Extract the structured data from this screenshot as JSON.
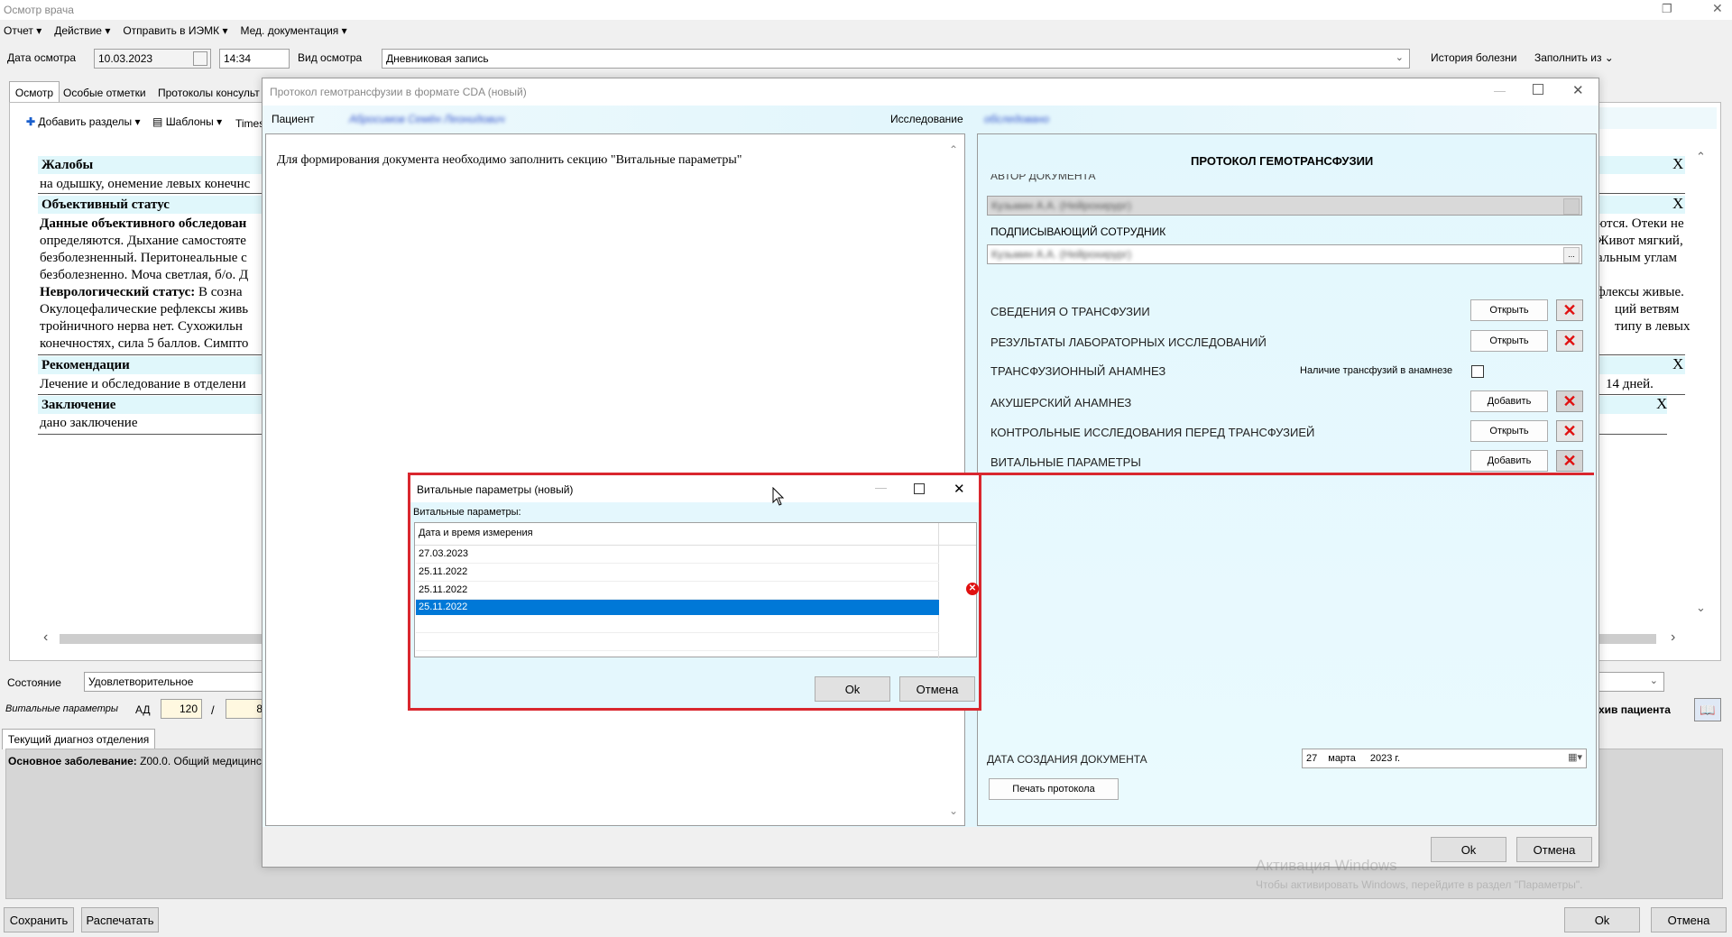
{
  "window": {
    "title": "Осмотр врача"
  },
  "menu": [
    "Отчет",
    "Действие",
    "Отправить в ИЭМК",
    "Мед. документация"
  ],
  "toolbar": {
    "date_label": "Дата осмотра",
    "date_value": "10.03.2023",
    "time_value": "14:34",
    "type_label": "Вид осмотра",
    "type_value": "Дневниковая запись",
    "history_link": "История болезни",
    "fill_from": "Заполнить из"
  },
  "tabs": [
    "Осмотр",
    "Особые отметки",
    "Протоколы консульт"
  ],
  "editor_toolbar": {
    "add_sections": "Добавить разделы",
    "templates": "Шаблоны",
    "times": "Times"
  },
  "sections": [
    {
      "title": "Жалобы",
      "text": "на одышку, онемение левых конечнс"
    },
    {
      "title": "Объективный статус",
      "text": ""
    }
  ],
  "body_lines": {
    "objective_title": "Данные объективного обследован",
    "l1": "определяются. Дыхание самостояте",
    "l2": "безболезненный. Перитонеальные с",
    "l3": "безболезненно. Моча светлая, б/о. Д",
    "neuro_title": "Неврологический статус:",
    "neuro_text": " В созна",
    "l5": "Окулоцефалические рефлексы живь",
    "l6": "тройничного нерва нет. Сухожильн",
    "l7": "конечностях, сила 5 баллов. Симпто",
    "rec_title": "Рекомендации",
    "rec_text": "Лечение и обследование в отделени",
    "concl_title": "Заключение",
    "concl_text": "дано заключение",
    "r1": "ются. Отеки не",
    "r2": "Живот мягкий,",
    "r3": "альным углам",
    "r5": "флексы живые.",
    "r6": "ций ветвям",
    "r7": "типу в левых",
    "r8": "14 дней."
  },
  "state": {
    "label": "Состояние",
    "value": "Удовлетворительное"
  },
  "vitals_row": {
    "label": "Витальные параметры",
    "ad_label": "АД",
    "ad_sys": "120",
    "slash": "/",
    "ad_dia": "8"
  },
  "diag_tab": "Текущий диагноз отделения",
  "diag": {
    "bold": "Основное заболевание:",
    "text": " Z00.0. Общий медицинск"
  },
  "archive": "хив пациента",
  "bottom": {
    "save": "Сохранить",
    "print": "Распечатать",
    "ok": "Ok",
    "cancel": "Отмена"
  },
  "cda": {
    "title": "Протокол гемотрансфузии в формате CDA (новый)",
    "patient_label": "Пациент",
    "patient_value": "Абросимов Семён Леонидович",
    "study_label": "Исследование",
    "study_value": "обследовано",
    "message": "Для формирования документа необходимо заполнить секцию \"Витальные параметры\"",
    "protocol_title": "ПРОТОКОЛ ГЕМОТРАНСФУЗИИ",
    "author_label": "АВТОР ДОКУМЕНТА",
    "author_value": "Кузьмин А.А. (Нейрохирург)",
    "signer_label": "ПОДПИСЫВАЮЩИЙ СОТРУДНИК",
    "signer_value": "Кузьмин А.А. (Нейрохирург)",
    "rows": [
      {
        "label": "СВЕДЕНИЯ О ТРАНСФУЗИИ",
        "btn": "Открыть"
      },
      {
        "label": "РЕЗУЛЬТАТЫ ЛАБОРАТОРНЫХ ИССЛЕДОВАНИЙ",
        "btn": "Открыть"
      },
      {
        "label": "ТРАНСФУЗИОННЫЙ АНАМНЕЗ",
        "check": "Наличие трансфузий в анамнезе"
      },
      {
        "label": "АКУШЕРСКИЙ АНАМНЕЗ",
        "btn": "Добавить"
      },
      {
        "label": "КОНТРОЛЬНЫЕ ИССЛЕДОВАНИЯ ПЕРЕД ТРАНСФУЗИЕЙ",
        "btn": "Открыть"
      },
      {
        "label": "ВИТАЛЬНЫЕ ПАРАМЕТРЫ",
        "btn": "Добавить"
      }
    ],
    "created_label": "ДАТА СОЗДАНИЯ ДОКУМЕНТА",
    "created_day": "27",
    "created_month": "марта",
    "created_year": "2023 г.",
    "print_btn": "Печать протокола",
    "ok": "Ok",
    "cancel": "Отмена"
  },
  "vitals": {
    "title": "Витальные параметры (новый)",
    "label": "Витальные параметры:",
    "column": "Дата и время измерения",
    "rows": [
      "27.03.2023",
      "25.11.2022",
      "25.11.2022",
      "25.11.2022"
    ],
    "selected_index": 3,
    "ok": "Ok",
    "cancel": "Отмена"
  },
  "watermark": {
    "line1": "Активация Windows",
    "line2": "Чтобы активировать Windows, перейдите в раздел \"Параметры\"."
  },
  "colors": {
    "highlight": "#d9272e",
    "selection": "#0078d7",
    "section_bg": "#e0f7fb"
  }
}
